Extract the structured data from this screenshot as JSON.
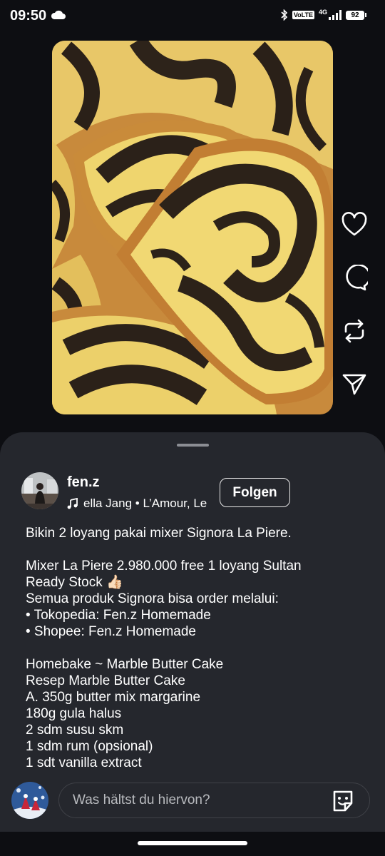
{
  "status_bar": {
    "time": "09:50",
    "volte": "VoLTE",
    "network": "4G",
    "battery": "92",
    "icons": [
      "cloud-icon",
      "bluetooth-icon",
      "signal-icon",
      "battery-icon"
    ]
  },
  "post": {
    "image_icon": "marble-cake-photo",
    "actions": [
      "heart-icon",
      "comment-icon",
      "repost-icon",
      "share-icon"
    ]
  },
  "sheet": {
    "username": "fen.z",
    "music": "ella Jang • L’Amour, Le",
    "follow_label": "Folgen",
    "caption": [
      "Bikin 2 loyang pakai mixer Signora La Piere.",
      "",
      "Mixer La Piere 2.980.000 free 1 loyang Sultan",
      "Ready Stock 👍🏻",
      "Semua produk Signora bisa order melalui:",
      "• Tokopedia: Fen.z Homemade",
      "• Shopee: Fen.z Homemade",
      "",
      "Homebake ~ Marble Butter Cake",
      "Resep Marble Butter Cake",
      "A. 350g butter mix margarine",
      "180g gula halus",
      "2 sdm susu skm",
      "1 sdm rum (opsional)",
      "1 sdt vanilla extract"
    ]
  },
  "comment": {
    "placeholder": "Was hältst du hiervon?",
    "icons": [
      "avatar",
      "sticker-icon"
    ]
  },
  "colors": {
    "background": "#0d0e12",
    "sheet": "#25272d",
    "text": "#ffffff",
    "placeholder": "#b9bbbf"
  }
}
